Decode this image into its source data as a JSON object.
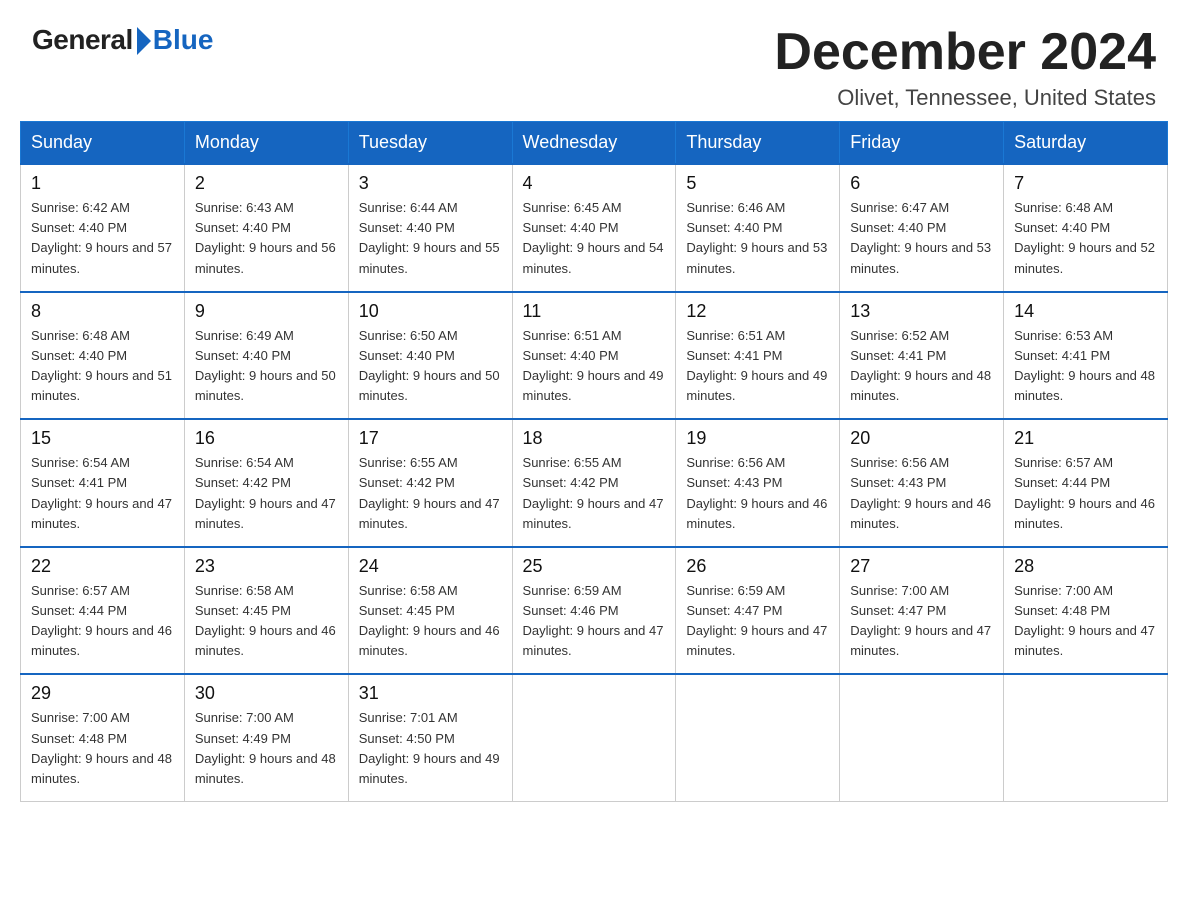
{
  "header": {
    "logo_general": "General",
    "logo_blue": "Blue",
    "month_title": "December 2024",
    "location": "Olivet, Tennessee, United States"
  },
  "days_of_week": [
    "Sunday",
    "Monday",
    "Tuesday",
    "Wednesday",
    "Thursday",
    "Friday",
    "Saturday"
  ],
  "weeks": [
    [
      {
        "day": "1",
        "sunrise": "6:42 AM",
        "sunset": "4:40 PM",
        "daylight": "9 hours and 57 minutes."
      },
      {
        "day": "2",
        "sunrise": "6:43 AM",
        "sunset": "4:40 PM",
        "daylight": "9 hours and 56 minutes."
      },
      {
        "day": "3",
        "sunrise": "6:44 AM",
        "sunset": "4:40 PM",
        "daylight": "9 hours and 55 minutes."
      },
      {
        "day": "4",
        "sunrise": "6:45 AM",
        "sunset": "4:40 PM",
        "daylight": "9 hours and 54 minutes."
      },
      {
        "day": "5",
        "sunrise": "6:46 AM",
        "sunset": "4:40 PM",
        "daylight": "9 hours and 53 minutes."
      },
      {
        "day": "6",
        "sunrise": "6:47 AM",
        "sunset": "4:40 PM",
        "daylight": "9 hours and 53 minutes."
      },
      {
        "day": "7",
        "sunrise": "6:48 AM",
        "sunset": "4:40 PM",
        "daylight": "9 hours and 52 minutes."
      }
    ],
    [
      {
        "day": "8",
        "sunrise": "6:48 AM",
        "sunset": "4:40 PM",
        "daylight": "9 hours and 51 minutes."
      },
      {
        "day": "9",
        "sunrise": "6:49 AM",
        "sunset": "4:40 PM",
        "daylight": "9 hours and 50 minutes."
      },
      {
        "day": "10",
        "sunrise": "6:50 AM",
        "sunset": "4:40 PM",
        "daylight": "9 hours and 50 minutes."
      },
      {
        "day": "11",
        "sunrise": "6:51 AM",
        "sunset": "4:40 PM",
        "daylight": "9 hours and 49 minutes."
      },
      {
        "day": "12",
        "sunrise": "6:51 AM",
        "sunset": "4:41 PM",
        "daylight": "9 hours and 49 minutes."
      },
      {
        "day": "13",
        "sunrise": "6:52 AM",
        "sunset": "4:41 PM",
        "daylight": "9 hours and 48 minutes."
      },
      {
        "day": "14",
        "sunrise": "6:53 AM",
        "sunset": "4:41 PM",
        "daylight": "9 hours and 48 minutes."
      }
    ],
    [
      {
        "day": "15",
        "sunrise": "6:54 AM",
        "sunset": "4:41 PM",
        "daylight": "9 hours and 47 minutes."
      },
      {
        "day": "16",
        "sunrise": "6:54 AM",
        "sunset": "4:42 PM",
        "daylight": "9 hours and 47 minutes."
      },
      {
        "day": "17",
        "sunrise": "6:55 AM",
        "sunset": "4:42 PM",
        "daylight": "9 hours and 47 minutes."
      },
      {
        "day": "18",
        "sunrise": "6:55 AM",
        "sunset": "4:42 PM",
        "daylight": "9 hours and 47 minutes."
      },
      {
        "day": "19",
        "sunrise": "6:56 AM",
        "sunset": "4:43 PM",
        "daylight": "9 hours and 46 minutes."
      },
      {
        "day": "20",
        "sunrise": "6:56 AM",
        "sunset": "4:43 PM",
        "daylight": "9 hours and 46 minutes."
      },
      {
        "day": "21",
        "sunrise": "6:57 AM",
        "sunset": "4:44 PM",
        "daylight": "9 hours and 46 minutes."
      }
    ],
    [
      {
        "day": "22",
        "sunrise": "6:57 AM",
        "sunset": "4:44 PM",
        "daylight": "9 hours and 46 minutes."
      },
      {
        "day": "23",
        "sunrise": "6:58 AM",
        "sunset": "4:45 PM",
        "daylight": "9 hours and 46 minutes."
      },
      {
        "day": "24",
        "sunrise": "6:58 AM",
        "sunset": "4:45 PM",
        "daylight": "9 hours and 46 minutes."
      },
      {
        "day": "25",
        "sunrise": "6:59 AM",
        "sunset": "4:46 PM",
        "daylight": "9 hours and 47 minutes."
      },
      {
        "day": "26",
        "sunrise": "6:59 AM",
        "sunset": "4:47 PM",
        "daylight": "9 hours and 47 minutes."
      },
      {
        "day": "27",
        "sunrise": "7:00 AM",
        "sunset": "4:47 PM",
        "daylight": "9 hours and 47 minutes."
      },
      {
        "day": "28",
        "sunrise": "7:00 AM",
        "sunset": "4:48 PM",
        "daylight": "9 hours and 47 minutes."
      }
    ],
    [
      {
        "day": "29",
        "sunrise": "7:00 AM",
        "sunset": "4:48 PM",
        "daylight": "9 hours and 48 minutes."
      },
      {
        "day": "30",
        "sunrise": "7:00 AM",
        "sunset": "4:49 PM",
        "daylight": "9 hours and 48 minutes."
      },
      {
        "day": "31",
        "sunrise": "7:01 AM",
        "sunset": "4:50 PM",
        "daylight": "9 hours and 49 minutes."
      },
      null,
      null,
      null,
      null
    ]
  ]
}
